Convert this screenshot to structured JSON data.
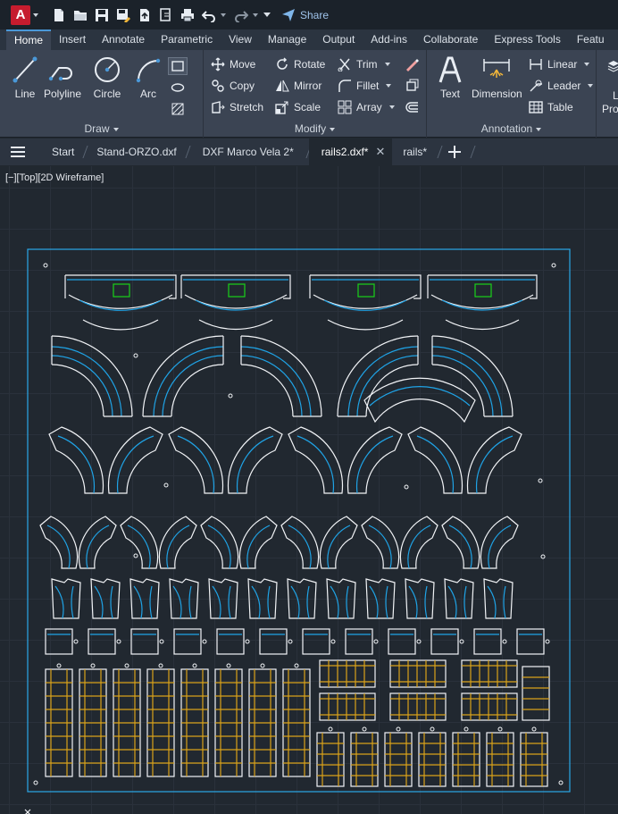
{
  "app": {
    "logo_letter": "A",
    "share_label": "Share"
  },
  "ribbon_tabs": [
    "Home",
    "Insert",
    "Annotate",
    "Parametric",
    "View",
    "Manage",
    "Output",
    "Add-ins",
    "Collaborate",
    "Express Tools",
    "Featu"
  ],
  "draw_panel": {
    "title": "Draw",
    "line": "Line",
    "polyline": "Polyline",
    "circle": "Circle",
    "arc": "Arc"
  },
  "modify_panel": {
    "title": "Modify",
    "move": "Move",
    "rotate": "Rotate",
    "trim": "Trim",
    "copy": "Copy",
    "mirror": "Mirror",
    "fillet": "Fillet",
    "stretch": "Stretch",
    "scale": "Scale",
    "array": "Array"
  },
  "annotation_panel": {
    "title": "Annotation",
    "text": "Text",
    "dimension": "Dimension",
    "linear": "Linear",
    "leader": "Leader",
    "table": "Table"
  },
  "extra_panel": {
    "label1": "L",
    "label2": "Pro"
  },
  "file_tabs": {
    "start": "Start",
    "tab1": "Stand-ORZO.dxf",
    "tab2": "DXF Marco Vela 2*",
    "tab3": "rails2.dxf*",
    "tab4": "rails*"
  },
  "viewport": {
    "label": "[−][Top][2D Wireframe]"
  },
  "colors": {
    "accent": "#4a98d8",
    "outline": "#f2f4f7",
    "rail_blue": "#1fa3e6",
    "rail_gold": "#d9a21a",
    "clip_green": "#19d219",
    "frame_blue": "#2aa8e8"
  }
}
